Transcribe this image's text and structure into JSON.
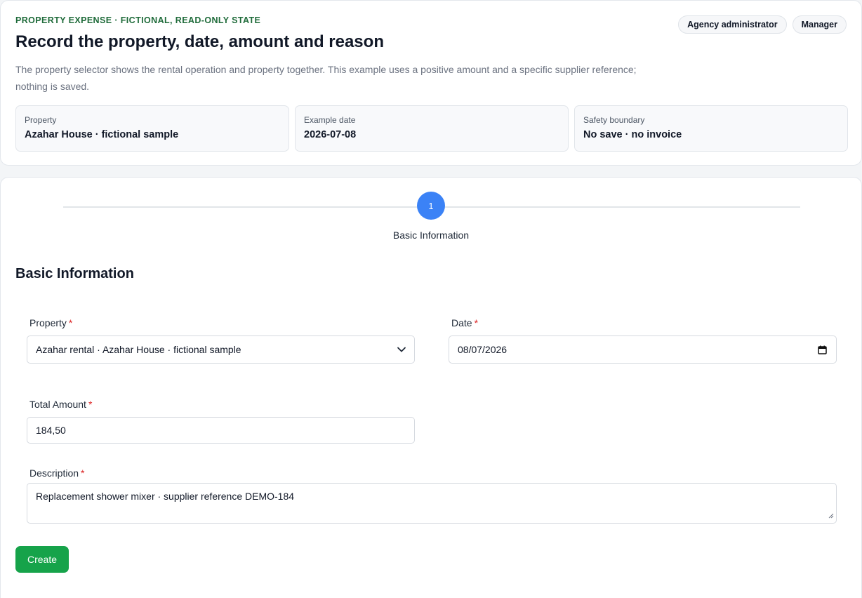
{
  "header": {
    "eyebrow": "PROPERTY EXPENSE · FICTIONAL, READ-ONLY STATE",
    "title": "Record the property, date, amount and reason",
    "intro": "The property selector shows the rental operation and property together. This example uses a positive amount and a specific supplier reference; nothing is saved.",
    "roles": [
      "Agency administrator",
      "Manager"
    ],
    "summary": [
      {
        "label": "Property",
        "value": "Azahar House · fictional sample"
      },
      {
        "label": "Example date",
        "value": "2026-07-08"
      },
      {
        "label": "Safety boundary",
        "value": "No save · no invoice"
      }
    ]
  },
  "stepper": {
    "step_number": "1",
    "step_label": "Basic Information"
  },
  "form": {
    "section_title": "Basic Information",
    "required_mark": "*",
    "property": {
      "label": "Property",
      "value": "Azahar rental · Azahar House · fictional sample",
      "icon": "chevron-down-icon"
    },
    "date": {
      "label": "Date",
      "value": "08/07/2026",
      "icon": "calendar-icon"
    },
    "amount": {
      "label": "Total Amount",
      "value": "184,50"
    },
    "description": {
      "label": "Description",
      "value": "Replacement shower mixer · supplier reference DEMO-184"
    },
    "create_label": "Create"
  },
  "colors": {
    "eyebrow": "#1f6b3a",
    "step_active": "#3b82f6",
    "primary_button": "#16a34a",
    "required": "#dc2626"
  }
}
